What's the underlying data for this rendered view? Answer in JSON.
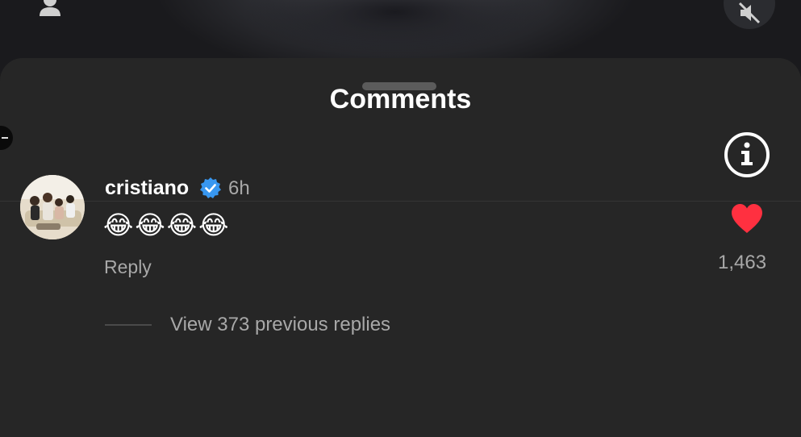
{
  "sheet": {
    "title": "Comments"
  },
  "comment": {
    "username": "cristiano",
    "verified": true,
    "time": "6h",
    "text": "😂😂😂😂",
    "reply_label": "Reply",
    "like_count": "1,463",
    "view_replies_label": "View 373 previous replies"
  },
  "colors": {
    "sheet_bg": "#262626",
    "like_red": "#ff3040",
    "verified_blue": "#3897f0",
    "muted_text": "#a8a8a8"
  },
  "icons": {
    "top_left": "user-icon",
    "top_right": "mute-icon",
    "info": "info-icon",
    "verified": "verified-badge-icon",
    "like": "heart-icon"
  }
}
